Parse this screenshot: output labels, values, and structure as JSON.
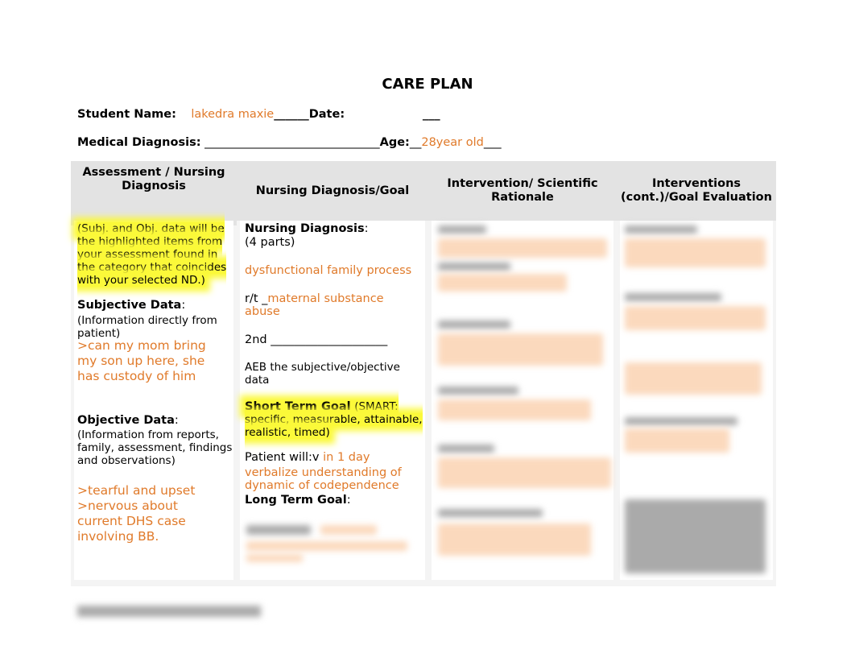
{
  "title": "CARE PLAN",
  "student": {
    "name_label": "Student Name:",
    "name_value": "lakedra maxie",
    "name_suffix": "______",
    "date_label": "Date:",
    "date_suffix": "___"
  },
  "medical": {
    "label": "Medical Diagnosis:",
    "blank": "______________________________",
    "age_label": "Age:",
    "age_prefix": "__",
    "age_value": "28year old",
    "age_suffix": "___"
  },
  "table": {
    "headers": [
      "Assessment / Nursing Diagnosis",
      "Nursing Diagnosis/Goal",
      "Intervention/ Scientific Rationale",
      "Interventions (cont.)/Goal Evaluation"
    ],
    "assessment": {
      "intro": "(Subj. and Obj. data will be the highlighted items from your assessment found in the category that coincides with your selected ND.)",
      "subjective_label": "Subjective Data",
      "subjective_hint": "(Information directly from patient)",
      "subjective_value": ">can my mom bring my son up here, she has custody of him",
      "objective_label": "Objective Data",
      "objective_hint": "(Information from reports, family, assessment, findings and observations)",
      "objective_value_1": ">tearful and upset",
      "objective_value_2": ">nervous about current DHS case involving BB."
    },
    "diagnosis_goal": {
      "nd_label": "Nursing Diagnosis",
      "nd_hint": "(4 parts)",
      "nd_value": "dysfunctional family process",
      "rt_prefix": "r/t _",
      "rt_value": "maternal substance abuse",
      "second_label": "2nd ____________________",
      "aeb": "AEB the subjective/objective data",
      "stg_label": "Short Term Goal",
      "stg_hint": "(SMART: specific, measurable, attainable, realistic, timed)",
      "patient_will": "Patient will:v",
      "stg_value_1": "in 1 day",
      "stg_value_2": "verbalize understanding of dynamic of codependence",
      "ltg_label": "Long Term Goal"
    }
  }
}
